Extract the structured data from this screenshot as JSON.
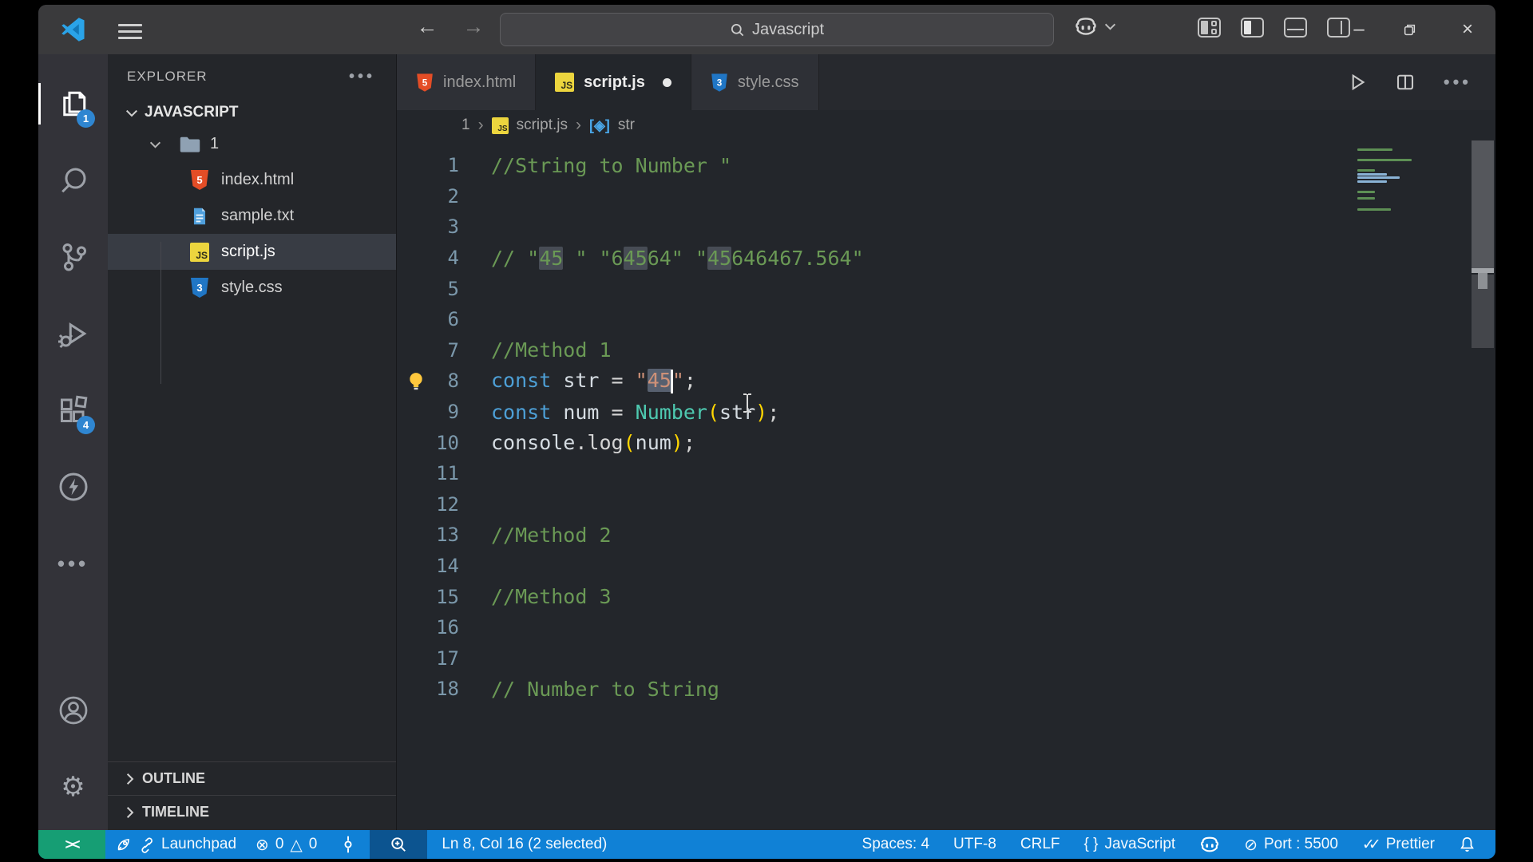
{
  "titlebar": {
    "search_value": "Javascript"
  },
  "activity_bar": {
    "badges": {
      "explorer": "1",
      "extensions": "4"
    }
  },
  "sidebar": {
    "title": "EXPLORER",
    "workspace": "JAVASCRIPT",
    "tree": [
      {
        "label": "1",
        "type": "folder",
        "expanded": true
      },
      {
        "label": "index.html",
        "type": "html"
      },
      {
        "label": "sample.txt",
        "type": "txt"
      },
      {
        "label": "script.js",
        "type": "js",
        "selected": true
      },
      {
        "label": "style.css",
        "type": "css"
      }
    ],
    "sections": [
      "OUTLINE",
      "TIMELINE"
    ]
  },
  "tabs": [
    {
      "label": "index.html",
      "icon": "html",
      "active": false,
      "dirty": false
    },
    {
      "label": "script.js",
      "icon": "js",
      "active": true,
      "dirty": true
    },
    {
      "label": "style.css",
      "icon": "css",
      "active": false,
      "dirty": false
    }
  ],
  "breadcrumb": {
    "folder": "1",
    "file": "script.js",
    "symbol": "str"
  },
  "editor": {
    "lightbulb_line": 8,
    "cursor": "Ln 8, Col 16",
    "lines": [
      {
        "n": "1",
        "tokens": [
          {
            "t": "//String to Number \"",
            "c": "cm"
          }
        ]
      },
      {
        "n": "2",
        "tokens": []
      },
      {
        "n": "3",
        "tokens": []
      },
      {
        "n": "4",
        "tokens": [
          {
            "t": "// \"",
            "c": "cm"
          },
          {
            "t": "45",
            "c": "cm hl"
          },
          {
            "t": " \" \"6",
            "c": "cm"
          },
          {
            "t": "45",
            "c": "cm hl"
          },
          {
            "t": "64\" \"",
            "c": "cm"
          },
          {
            "t": "45",
            "c": "cm hl"
          },
          {
            "t": "646467.564\"",
            "c": "cm"
          }
        ]
      },
      {
        "n": "5",
        "tokens": []
      },
      {
        "n": "6",
        "tokens": []
      },
      {
        "n": "7",
        "tokens": [
          {
            "t": "//Method 1",
            "c": "cm"
          }
        ]
      },
      {
        "n": "8",
        "tokens": [
          {
            "t": "const",
            "c": "kw"
          },
          {
            "t": " ",
            "c": "pl"
          },
          {
            "t": "str",
            "c": "vr"
          },
          {
            "t": " = ",
            "c": "pl"
          },
          {
            "t": "\"",
            "c": "st"
          },
          {
            "t": "45",
            "c": "st sel"
          },
          {
            "t": "",
            "c": "caret"
          },
          {
            "t": "\"",
            "c": "st"
          },
          {
            "t": ";",
            "c": "pl"
          }
        ]
      },
      {
        "n": "9",
        "tokens": [
          {
            "t": "const",
            "c": "kw"
          },
          {
            "t": " ",
            "c": "pl"
          },
          {
            "t": "num",
            "c": "vr"
          },
          {
            "t": " = ",
            "c": "pl"
          },
          {
            "t": "Number",
            "c": "cl"
          },
          {
            "t": "(",
            "c": "pa"
          },
          {
            "t": "str",
            "c": "vr"
          },
          {
            "t": ")",
            "c": "pa"
          },
          {
            "t": ";",
            "c": "pl"
          }
        ]
      },
      {
        "n": "10",
        "tokens": [
          {
            "t": "console",
            "c": "vr"
          },
          {
            "t": ".",
            "c": "pl"
          },
          {
            "t": "log",
            "c": "fn"
          },
          {
            "t": "(",
            "c": "pa"
          },
          {
            "t": "num",
            "c": "vr"
          },
          {
            "t": ")",
            "c": "pa"
          },
          {
            "t": ";",
            "c": "pl"
          }
        ]
      },
      {
        "n": "11",
        "tokens": []
      },
      {
        "n": "12",
        "tokens": []
      },
      {
        "n": "13",
        "tokens": [
          {
            "t": "//Method 2",
            "c": "cm"
          }
        ]
      },
      {
        "n": "14",
        "tokens": []
      },
      {
        "n": "15",
        "tokens": [
          {
            "t": "//Method 3",
            "c": "cm"
          }
        ]
      },
      {
        "n": "16",
        "tokens": []
      },
      {
        "n": "17",
        "tokens": []
      },
      {
        "n": "18",
        "tokens": [
          {
            "t": "// Number to String",
            "c": "cm"
          }
        ]
      }
    ]
  },
  "status_bar": {
    "remote_label": "><",
    "launchpad": "Launchpad",
    "errors": "0",
    "warnings": "0",
    "cursor_position": "Ln 8, Col 16 (2 selected)",
    "indentation": "Spaces: 4",
    "encoding": "UTF-8",
    "eol": "CRLF",
    "language_braces": "{ }",
    "language": "JavaScript",
    "port": "Port : 5500",
    "formatter": "Prettier"
  },
  "colors": {
    "status_blue": "#1081d6",
    "remote_green": "#169e74",
    "badge_blue": "#2f86d1",
    "comment_green": "#6a9955",
    "keyword_blue": "#4d9fd6",
    "string_orange": "#ce9178",
    "class_teal": "#4ec9b0",
    "paren_gold": "#ffd602",
    "bulb_yellow": "#ffc83d"
  }
}
